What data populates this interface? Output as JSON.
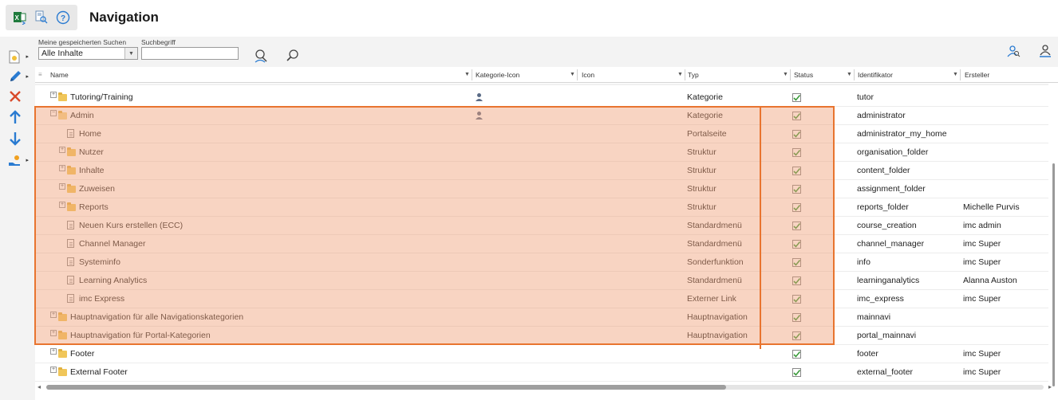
{
  "page": {
    "title": "Navigation"
  },
  "top_icons": [
    {
      "name": "excel-export-icon"
    },
    {
      "name": "document-search-icon"
    },
    {
      "name": "help-icon"
    }
  ],
  "left_toolbar": [
    {
      "name": "new-item-icon",
      "has_menu": true,
      "color": "#d9a21a"
    },
    {
      "name": "edit-pencil-icon",
      "has_menu": true,
      "color": "#2a7bd1"
    },
    {
      "name": "delete-x-icon",
      "has_menu": false,
      "color": "#d94a2a"
    },
    {
      "name": "move-up-icon",
      "has_menu": false,
      "color": "#2a7bd1"
    },
    {
      "name": "move-down-icon",
      "has_menu": false,
      "color": "#2a7bd1"
    },
    {
      "name": "assign-hand-icon",
      "has_menu": true,
      "color": "#2a7bd1"
    }
  ],
  "search": {
    "saved_label": "Meine gespeicherten Suchen",
    "saved_value": "Alle Inhalte",
    "term_label": "Suchbegriff",
    "term_value": ""
  },
  "columns": [
    {
      "key": "name",
      "label": "Name"
    },
    {
      "key": "kategorie_icon",
      "label": "Kategorie-Icon"
    },
    {
      "key": "icon",
      "label": "Icon"
    },
    {
      "key": "typ",
      "label": "Typ"
    },
    {
      "key": "status",
      "label": "Status"
    },
    {
      "key": "identifikator",
      "label": "Identifikator"
    },
    {
      "key": "ersteller",
      "label": "Ersteller"
    }
  ],
  "rows": [
    {
      "level": 0,
      "expander": "+",
      "node": "folder",
      "name": "Tutoring/Training",
      "cat_icon": "user-badge-icon",
      "typ": "Kategorie",
      "status": true,
      "ident": "tutor",
      "ersteller": ""
    },
    {
      "level": 0,
      "expander": "-",
      "node": "folder-open",
      "name": "Admin",
      "cat_icon": "user-gear-icon",
      "typ": "Kategorie",
      "status": true,
      "ident": "administrator",
      "ersteller": ""
    },
    {
      "level": 1,
      "expander": "",
      "node": "doc",
      "name": "Home",
      "cat_icon": "",
      "typ": "Portalseite",
      "status": true,
      "ident": "administrator_my_home",
      "ersteller": ""
    },
    {
      "level": 1,
      "expander": "+",
      "node": "folder",
      "name": "Nutzer",
      "cat_icon": "",
      "typ": "Struktur",
      "status": true,
      "ident": "organisation_folder",
      "ersteller": ""
    },
    {
      "level": 1,
      "expander": "+",
      "node": "folder",
      "name": "Inhalte",
      "cat_icon": "",
      "typ": "Struktur",
      "status": true,
      "ident": "content_folder",
      "ersteller": ""
    },
    {
      "level": 1,
      "expander": "+",
      "node": "folder",
      "name": "Zuweisen",
      "cat_icon": "",
      "typ": "Struktur",
      "status": true,
      "ident": "assignment_folder",
      "ersteller": ""
    },
    {
      "level": 1,
      "expander": "+",
      "node": "folder",
      "name": "Reports",
      "cat_icon": "",
      "typ": "Struktur",
      "status": true,
      "ident": "reports_folder",
      "ersteller": "Michelle Purvis"
    },
    {
      "level": 1,
      "expander": "",
      "node": "doc",
      "name": "Neuen Kurs erstellen (ECC)",
      "cat_icon": "",
      "typ": "Standardmenü",
      "status": true,
      "ident": "course_creation",
      "ersteller": "imc admin"
    },
    {
      "level": 1,
      "expander": "",
      "node": "doc",
      "name": "Channel Manager",
      "cat_icon": "",
      "typ": "Standardmenü",
      "status": true,
      "ident": "channel_manager",
      "ersteller": "imc Super"
    },
    {
      "level": 1,
      "expander": "",
      "node": "doc",
      "name": "Systeminfo",
      "cat_icon": "",
      "typ": "Sonderfunktion",
      "status": true,
      "ident": "info",
      "ersteller": "imc Super"
    },
    {
      "level": 1,
      "expander": "",
      "node": "doc",
      "name": "Learning Analytics",
      "cat_icon": "",
      "typ": "Standardmenü",
      "status": true,
      "ident": "learninganalytics",
      "ersteller": "Alanna Auston"
    },
    {
      "level": 1,
      "expander": "",
      "node": "doc",
      "name": "imc Express",
      "cat_icon": "",
      "typ": "Externer Link",
      "status": true,
      "ident": "imc_express",
      "ersteller": "imc Super"
    },
    {
      "level": 0,
      "expander": "+",
      "node": "folder",
      "name": "Hauptnavigation für alle Navigationskategorien",
      "cat_icon": "",
      "typ": "Hauptnavigation",
      "status": true,
      "ident": "mainnavi",
      "ersteller": ""
    },
    {
      "level": 0,
      "expander": "+",
      "node": "folder",
      "name": "Hauptnavigation für Portal-Kategorien",
      "cat_icon": "",
      "typ": "Hauptnavigation",
      "status": true,
      "ident": "portal_mainnavi",
      "ersteller": ""
    },
    {
      "level": 0,
      "expander": "+",
      "node": "folder",
      "name": "Footer",
      "cat_icon": "",
      "typ": "",
      "status": true,
      "ident": "footer",
      "ersteller": "imc Super"
    },
    {
      "level": 0,
      "expander": "+",
      "node": "folder",
      "name": "External Footer",
      "cat_icon": "",
      "typ": "",
      "status": true,
      "ident": "external_footer",
      "ersteller": "imc Super"
    }
  ],
  "colors": {
    "accent": "#e8742f",
    "highlight": "#f5c3aa",
    "check": "#3a9a3a",
    "link_blue": "#2a7bd1"
  }
}
